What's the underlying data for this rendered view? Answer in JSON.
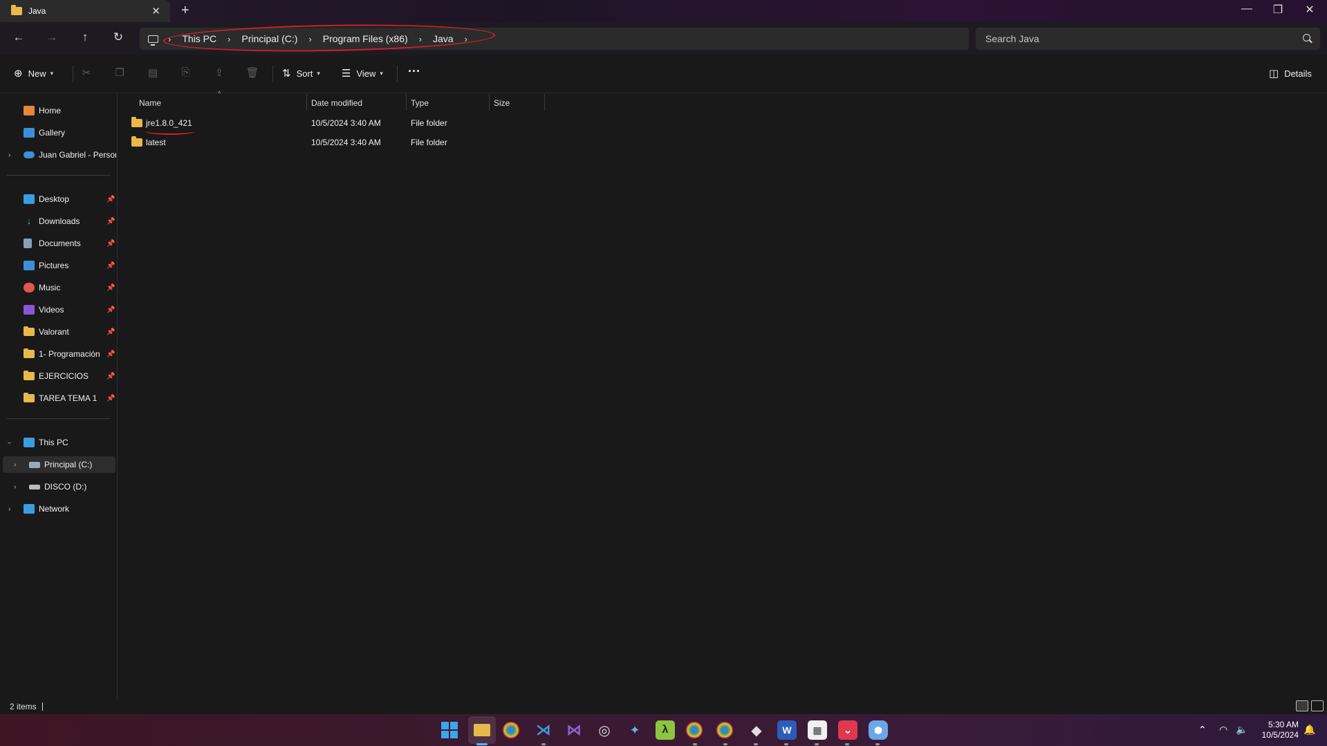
{
  "window": {
    "tab_title": "Java",
    "new_tab": "+",
    "close_tab": "✕",
    "minimize": "—",
    "restore": "❐",
    "close": "✕"
  },
  "nav": {
    "back": "←",
    "forward": "→",
    "up": "↑",
    "refresh": "↻"
  },
  "breadcrumb": [
    "This PC",
    "Principal (C:)",
    "Program Files (x86)",
    "Java"
  ],
  "search": {
    "placeholder": "Search Java"
  },
  "toolbar": {
    "new_label": "New",
    "sort_label": "Sort",
    "view_label": "View",
    "more_label": "···",
    "details_label": "Details",
    "icons": [
      "cut-icon",
      "copy-icon",
      "paste-icon",
      "rename-icon",
      "share-icon",
      "delete-icon"
    ]
  },
  "sidebar": {
    "top": [
      {
        "label": "Home",
        "icon": "home-icon"
      },
      {
        "label": "Gallery",
        "icon": "gallery-icon"
      },
      {
        "label": "Juan Gabriel - Personal",
        "icon": "onedrive-icon"
      }
    ],
    "quick": [
      {
        "label": "Desktop",
        "icon": "desktop-icon"
      },
      {
        "label": "Downloads",
        "icon": "downloads-icon"
      },
      {
        "label": "Documents",
        "icon": "documents-icon"
      },
      {
        "label": "Pictures",
        "icon": "pictures-icon"
      },
      {
        "label": "Music",
        "icon": "music-icon"
      },
      {
        "label": "Videos",
        "icon": "videos-icon"
      },
      {
        "label": "Valorant",
        "icon": "folder-icon"
      },
      {
        "label": "1- Programación",
        "icon": "folder-icon"
      },
      {
        "label": "EJERCICIOS",
        "icon": "folder-icon"
      },
      {
        "label": "TAREA TEMA 1",
        "icon": "folder-icon"
      }
    ],
    "devices": [
      {
        "label": "This PC",
        "icon": "pc-icon"
      },
      {
        "label": "Principal (C:)",
        "icon": "drive-icon"
      },
      {
        "label": "DISCO (D:)",
        "icon": "drive-icon"
      },
      {
        "label": "Network",
        "icon": "network-icon"
      }
    ]
  },
  "columns": [
    "Name",
    "Date modified",
    "Type",
    "Size"
  ],
  "files": [
    {
      "name": "jre1.8.0_421",
      "date": "10/5/2024 3:40 AM",
      "type": "File folder",
      "size": ""
    },
    {
      "name": "latest",
      "date": "10/5/2024 3:40 AM",
      "type": "File folder",
      "size": ""
    }
  ],
  "status": {
    "items": "2 items"
  },
  "taskbar": {
    "apps": [
      "start-icon",
      "file-explorer-icon",
      "chrome-icon",
      "vscode-icon",
      "visual-studio-icon",
      "obs-icon",
      "davinci-icon",
      "lambda-icon",
      "chrome-profile-icon",
      "chrome-profile-2-icon",
      "git-icon",
      "word-icon",
      "ms-store-icon",
      "pocket-icon",
      "shield-icon"
    ],
    "time": "5:30 AM",
    "date": "10/5/2024"
  },
  "colors": {
    "annotation": "#d11f2a",
    "folder": "#e8b94a",
    "accent": "#5bb4ff"
  }
}
